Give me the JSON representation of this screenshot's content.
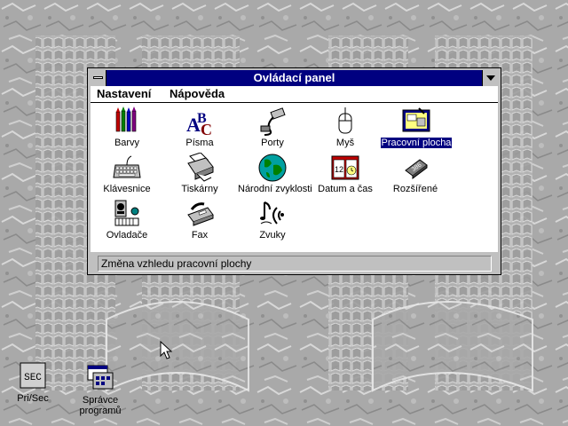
{
  "window": {
    "title": "Ovládací panel",
    "menu": [
      "Nastavení",
      "Nápověda"
    ],
    "items": [
      {
        "label": "Barvy",
        "icon": "crayons-icon"
      },
      {
        "label": "Písma",
        "icon": "fonts-icon"
      },
      {
        "label": "Porty",
        "icon": "port-plug-icon"
      },
      {
        "label": "Myš",
        "icon": "mouse-icon"
      },
      {
        "label": "Pracovní plocha",
        "icon": "desktop-icon"
      },
      {
        "label": "Klávesnice",
        "icon": "keyboard-icon"
      },
      {
        "label": "Tiskárny",
        "icon": "printer-icon"
      },
      {
        "label": "Národní zvyklosti",
        "icon": "globe-icon"
      },
      {
        "label": "Datum a čas",
        "icon": "calendar-clock-icon"
      },
      {
        "label": "Rozšířené",
        "icon": "chip-icon"
      },
      {
        "label": "Ovladače",
        "icon": "drivers-icon"
      },
      {
        "label": "Fax",
        "icon": "fax-icon"
      },
      {
        "label": "Zvuky",
        "icon": "sounds-icon"
      }
    ],
    "selected_item": "Pracovní plocha",
    "status": "Změna vzhledu pracovní plochy"
  },
  "desktop_icons": [
    {
      "label": "Pri/Sec",
      "glyph": "SEC",
      "icon": "pri-sec-icon"
    },
    {
      "label": "Správce programů",
      "icon": "program-manager-icon"
    }
  ],
  "colors": {
    "titlebar": "#000080",
    "selection": "#000080",
    "window_face": "#c0c0c0",
    "desktop": "#a8a8a8"
  }
}
